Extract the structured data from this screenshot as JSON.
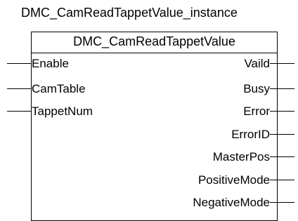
{
  "instance_name": "DMC_CamReadTappetValue_instance",
  "function_block": {
    "name": "DMC_CamReadTappetValue",
    "inputs": [
      "Enable",
      "CamTable",
      "TappetNum"
    ],
    "outputs": [
      "Vaild",
      "Busy",
      "Error",
      "ErrorID",
      "MasterPos",
      "PositiveMode",
      "NegativeMode"
    ]
  }
}
